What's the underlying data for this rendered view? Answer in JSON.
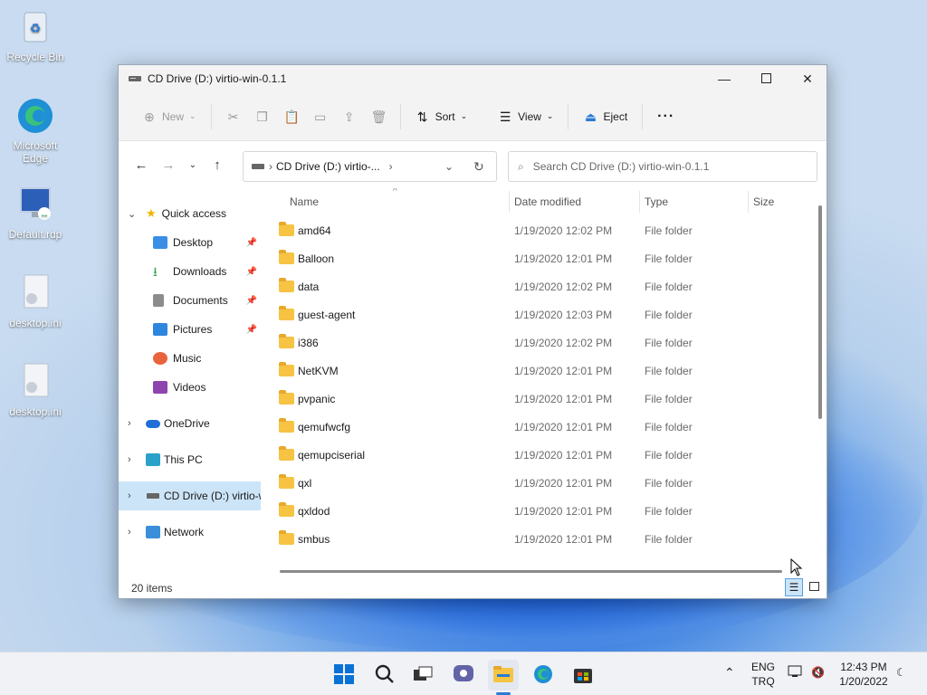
{
  "desktop": {
    "icons": [
      {
        "label": "Recycle Bin"
      },
      {
        "label": "Microsoft Edge"
      },
      {
        "label": "Default.rdp"
      },
      {
        "label": "desktop.ini"
      },
      {
        "label": "desktop.ini"
      }
    ]
  },
  "window": {
    "title": "CD Drive (D:) virtio-win-0.1.1",
    "minimize_icon": "minimize-icon",
    "maximize_icon": "maximize-icon",
    "close_icon": "close-icon"
  },
  "commandbar": {
    "new_label": "New",
    "sort_label": "Sort",
    "view_label": "View",
    "eject_label": "Eject",
    "more_label": "···"
  },
  "address": {
    "path_label": "CD Drive (D:) virtio-...",
    "search_placeholder": "Search CD Drive (D:) virtio-win-0.1.1"
  },
  "nav": {
    "quick_access": "Quick access",
    "items": [
      {
        "label": "Desktop",
        "color": "#3a8ee6"
      },
      {
        "label": "Downloads",
        "color": "#2fa34a"
      },
      {
        "label": "Documents",
        "color": "#8c8c8c"
      },
      {
        "label": "Pictures",
        "color": "#2e86de"
      },
      {
        "label": "Music",
        "color": "#e8643c"
      },
      {
        "label": "Videos",
        "color": "#8e44ad"
      }
    ],
    "onedrive": "OneDrive",
    "thispc": "This PC",
    "cddrive": "CD Drive (D:) virtio-w",
    "network": "Network"
  },
  "columns": {
    "name": "Name",
    "date": "Date modified",
    "type": "Type",
    "size": "Size"
  },
  "files": [
    {
      "name": "amd64",
      "date": "1/19/2020 12:02 PM",
      "type": "File folder"
    },
    {
      "name": "Balloon",
      "date": "1/19/2020 12:01 PM",
      "type": "File folder"
    },
    {
      "name": "data",
      "date": "1/19/2020 12:02 PM",
      "type": "File folder"
    },
    {
      "name": "guest-agent",
      "date": "1/19/2020 12:03 PM",
      "type": "File folder"
    },
    {
      "name": "i386",
      "date": "1/19/2020 12:02 PM",
      "type": "File folder"
    },
    {
      "name": "NetKVM",
      "date": "1/19/2020 12:01 PM",
      "type": "File folder"
    },
    {
      "name": "pvpanic",
      "date": "1/19/2020 12:01 PM",
      "type": "File folder"
    },
    {
      "name": "qemufwcfg",
      "date": "1/19/2020 12:01 PM",
      "type": "File folder"
    },
    {
      "name": "qemupciserial",
      "date": "1/19/2020 12:01 PM",
      "type": "File folder"
    },
    {
      "name": "qxl",
      "date": "1/19/2020 12:01 PM",
      "type": "File folder"
    },
    {
      "name": "qxldod",
      "date": "1/19/2020 12:01 PM",
      "type": "File folder"
    },
    {
      "name": "smbus",
      "date": "1/19/2020 12:01 PM",
      "type": "File folder"
    }
  ],
  "status": {
    "item_count": "20 items"
  },
  "tray": {
    "lang1": "ENG",
    "lang2": "TRQ",
    "time": "12:43 PM",
    "date": "1/20/2022"
  }
}
